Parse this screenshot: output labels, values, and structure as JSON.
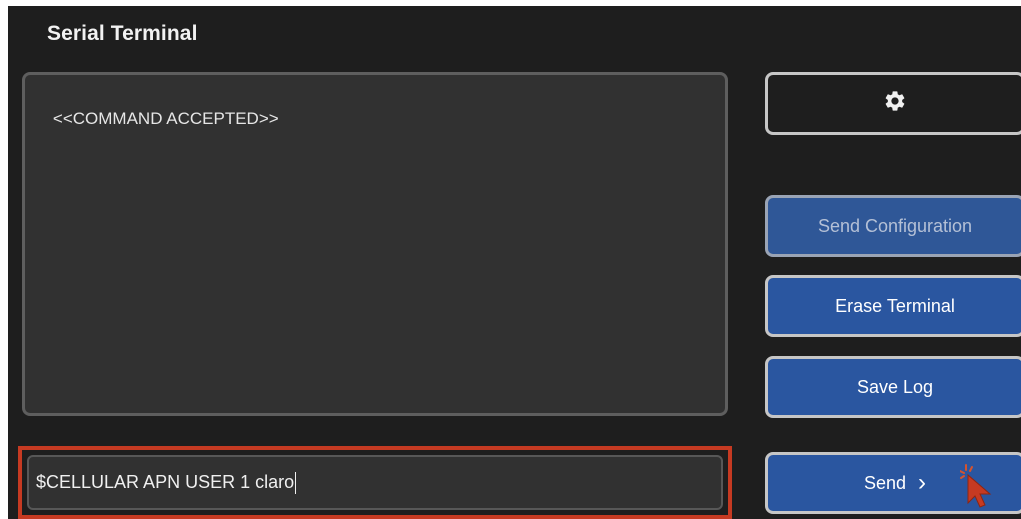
{
  "header": {
    "title": "Serial Terminal"
  },
  "terminal": {
    "output": "<<COMMAND ACCEPTED>>"
  },
  "buttons": {
    "settings_icon": "gear-icon",
    "send_configuration": "Send Configuration",
    "erase_terminal": "Erase Terminal",
    "save_log": "Save Log",
    "send": "Send",
    "send_chevron": "›"
  },
  "command_input": {
    "value": "$CELLULAR APN USER 1 claro"
  },
  "colors": {
    "background": "#1e1e1e",
    "panel": "#313131",
    "button_blue": "#2a56a0",
    "highlight_red": "#c63a22"
  }
}
